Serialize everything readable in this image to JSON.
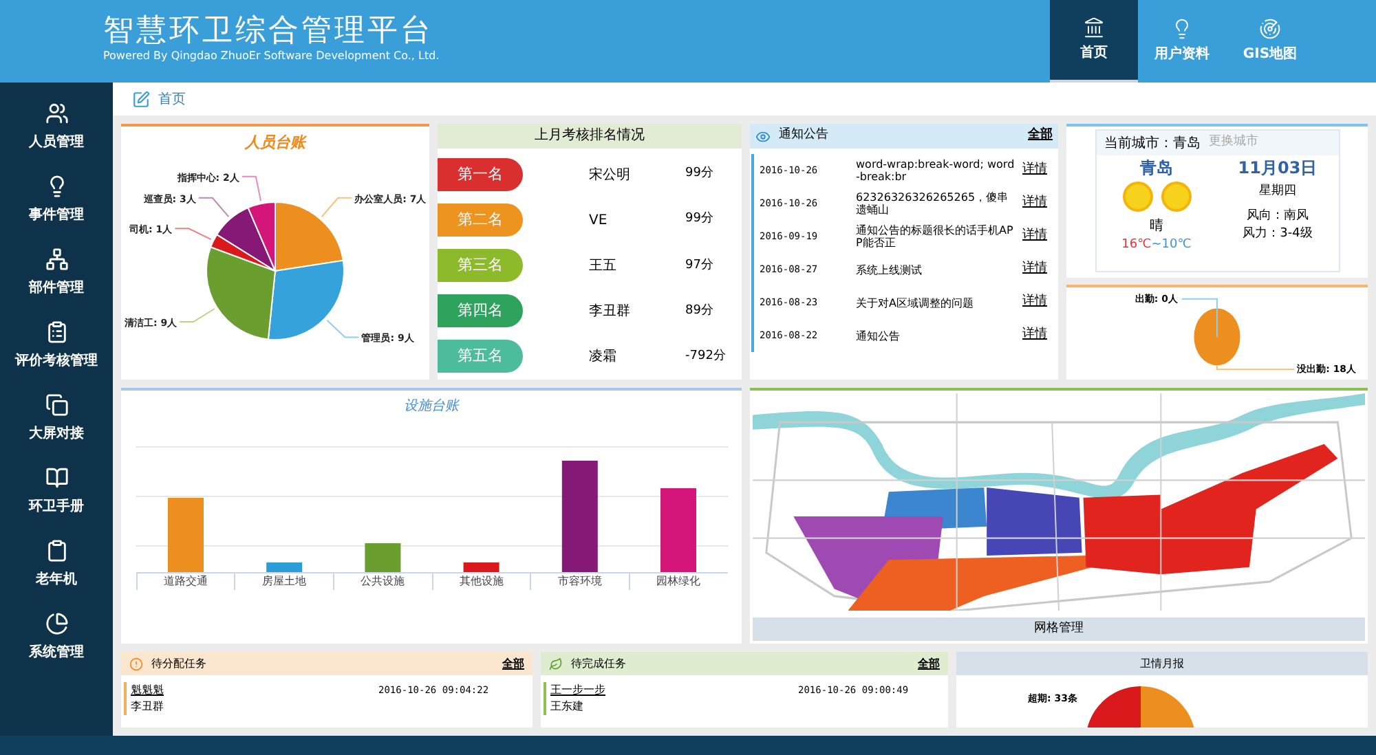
{
  "header": {
    "title": "智慧环卫综合管理平台",
    "subtitle": "Powered By Qingdao ZhuoEr Software Development Co., Ltd.",
    "tabs": [
      {
        "label": "首页",
        "kind": "home",
        "selected": true
      },
      {
        "label": "用户资料",
        "kind": "user",
        "selected": false
      },
      {
        "label": "GIS地图",
        "kind": "gis",
        "selected": false
      }
    ]
  },
  "sidebar": {
    "items": [
      {
        "label": "人员管理",
        "kind": "people"
      },
      {
        "label": "事件管理",
        "kind": "event"
      },
      {
        "label": "部件管理",
        "kind": "part"
      },
      {
        "label": "评价考核管理",
        "kind": "review"
      },
      {
        "label": "大屏对接",
        "kind": "screen"
      },
      {
        "label": "环卫手册",
        "kind": "manual"
      },
      {
        "label": "老年机",
        "kind": "phone"
      },
      {
        "label": "系统管理",
        "kind": "system"
      }
    ]
  },
  "breadcrumb": "首页",
  "staff_panel": {
    "chart_data": {
      "type": "pie",
      "title": "人员台账",
      "categories": [
        "办公室人员: 7人",
        "管理员: 9人",
        "清洁工: 9人",
        "司机: 1人",
        "巡查员: 3人",
        "指挥中心: 2人"
      ],
      "series": [
        {
          "values": [
            7,
            9,
            9,
            1,
            3,
            2
          ]
        }
      ]
    }
  },
  "ranking": {
    "title": "上月考核排名情况",
    "rows": [
      {
        "rank": "第一名",
        "name": "宋公明",
        "score": "99分",
        "color": "#d9302f"
      },
      {
        "rank": "第二名",
        "name": "VE",
        "score": "99分",
        "color": "#ec9320"
      },
      {
        "rank": "第三名",
        "name": "王五",
        "score": "97分",
        "color": "#8dba2b"
      },
      {
        "rank": "第四名",
        "name": "李丑群",
        "score": "89分",
        "color": "#2ea35d"
      },
      {
        "rank": "第五名",
        "name": "凌霜",
        "score": "-792分",
        "color": "#4cbc9c"
      }
    ]
  },
  "notices": {
    "title": "通知公告",
    "all_link": "全部",
    "rows": [
      {
        "date": "2016-10-26",
        "text": "word-wrap:break-word; word-break:br",
        "link": "详情"
      },
      {
        "date": "2016-10-26",
        "text": "62326326326265265，傻串遗蛹山",
        "link": "详情"
      },
      {
        "date": "2016-09-19",
        "text": "通知公告的标题很长的话手机APP能否正",
        "link": "详情"
      },
      {
        "date": "2016-08-27",
        "text": "系统上线测试",
        "link": "详情"
      },
      {
        "date": "2016-08-23",
        "text": "关于对A区域调整的问题",
        "link": "详情"
      },
      {
        "date": "2016-08-22",
        "text": "通知公告",
        "link": "详情"
      }
    ]
  },
  "weather": {
    "city_label": "当前城市：青岛",
    "change_city": "更换城市",
    "city": "青岛",
    "date": "11月03日",
    "weekday": "星期四",
    "condition": "晴",
    "high": "16℃",
    "low": "~10℃",
    "wind_dir": "风向：南风",
    "wind_force": "风力：3-4级"
  },
  "attendance": {
    "chart_data": {
      "type": "pie",
      "categories": [
        "出勤: 0人",
        "没出勤: 18人"
      ],
      "series": [
        {
          "values": [
            0,
            18
          ]
        }
      ]
    }
  },
  "facilities": {
    "title": "设施台账",
    "categories": [
      {
        "label": "道路交通",
        "color": "#ec8f1e"
      },
      {
        "label": "房屋土地",
        "color": "#2b9ed8"
      },
      {
        "label": "公共设施",
        "color": "#6a9e2e"
      },
      {
        "label": "其他设施",
        "color": "#d9191c"
      },
      {
        "label": "市容环境",
        "color": "#861975"
      },
      {
        "label": "园林绿化",
        "color": "#d41579"
      }
    ]
  },
  "map": {
    "kind": "picture",
    "caption": "网格管理"
  },
  "tasks": [
    {
      "title": "待分配任务",
      "kind": "pending",
      "all_link": "全部",
      "item": {
        "name": "魁魁魁",
        "time": "2016-10-26 09:04:22",
        "person": "李丑群"
      }
    },
    {
      "title": "待完成任务",
      "kind": "doing",
      "all_link": "全部",
      "item": {
        "name": "王一步一步",
        "time": "2016-10-26 09:00:49",
        "person": "王东建"
      }
    }
  ],
  "report": {
    "title": "卫情月报",
    "label": "超期: 33条"
  }
}
